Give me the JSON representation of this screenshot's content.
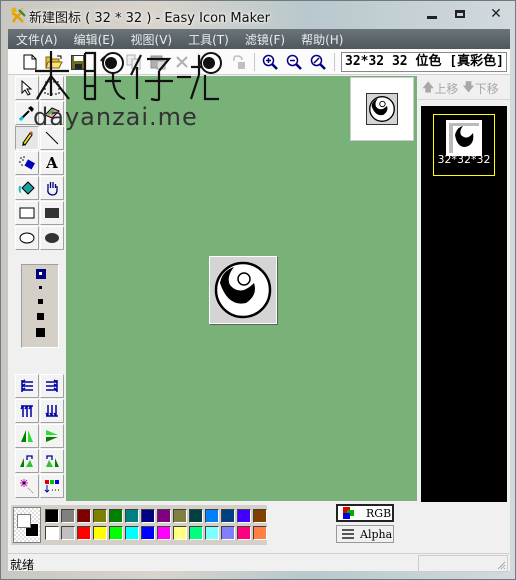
{
  "window": {
    "title": "新建图标 ( 32 * 32 ) - Easy Icon Maker",
    "controls": {
      "minimize": "—",
      "maximize": "□",
      "close": "✕"
    }
  },
  "menu": [
    "文件(A)",
    "编辑(E)",
    "视图(V)",
    "工具(T)",
    "滤镜(F)",
    "帮助(H)"
  ],
  "toolbar": {
    "buttons": [
      {
        "name": "new",
        "icon": "new-file-icon",
        "enabled": true
      },
      {
        "name": "open",
        "icon": "open-folder-icon",
        "enabled": true
      },
      {
        "name": "save",
        "icon": "save-icon",
        "enabled": true
      },
      {
        "name": "cut",
        "icon": "cut-icon",
        "enabled": false
      },
      {
        "name": "copy",
        "icon": "copy-icon",
        "enabled": false
      },
      {
        "name": "paste",
        "icon": "paste-icon",
        "enabled": false
      },
      {
        "name": "delete",
        "icon": "delete-icon",
        "enabled": false
      },
      {
        "name": "undo",
        "icon": "undo-icon",
        "enabled": true
      },
      {
        "name": "redo",
        "icon": "redo-icon",
        "enabled": false
      },
      {
        "name": "zoom-in",
        "icon": "zoom-in-icon",
        "enabled": true
      },
      {
        "name": "zoom-out",
        "icon": "zoom-out-icon",
        "enabled": true
      },
      {
        "name": "zoom-fit",
        "icon": "zoom-fit-icon",
        "enabled": true
      }
    ],
    "format": "32*32  32 位色 [真彩色]"
  },
  "tools": [
    {
      "name": "select",
      "icon": "arrow-select-icon"
    },
    {
      "name": "rect-select",
      "icon": "rect-select-icon"
    },
    {
      "name": "eyedropper",
      "icon": "eyedropper-icon"
    },
    {
      "name": "eraser",
      "icon": "eraser-icon"
    },
    {
      "name": "pencil",
      "icon": "pencil-icon",
      "active": true
    },
    {
      "name": "line",
      "icon": "line-icon"
    },
    {
      "name": "spray",
      "icon": "spray-icon"
    },
    {
      "name": "text",
      "icon": "text-icon",
      "glyph": "A"
    },
    {
      "name": "fill",
      "icon": "paint-bucket-icon"
    },
    {
      "name": "hand",
      "icon": "hand-icon"
    },
    {
      "name": "rectangle",
      "icon": "rectangle-icon"
    },
    {
      "name": "filled-rectangle",
      "icon": "filled-rectangle-icon"
    },
    {
      "name": "ellipse",
      "icon": "ellipse-icon"
    },
    {
      "name": "filled-ellipse",
      "icon": "filled-ellipse-icon"
    }
  ],
  "brush_sizes": {
    "options": [
      1,
      2,
      3,
      4,
      5
    ],
    "selected": 1
  },
  "transforms": [
    {
      "name": "shift-left",
      "icon": "shift-left-icon"
    },
    {
      "name": "shift-right",
      "icon": "shift-right-icon"
    },
    {
      "name": "shift-up",
      "icon": "shift-up-icon"
    },
    {
      "name": "shift-down",
      "icon": "shift-down-icon"
    },
    {
      "name": "flip-horizontal",
      "icon": "flip-horizontal-icon"
    },
    {
      "name": "flip-vertical",
      "icon": "flip-vertical-icon"
    },
    {
      "name": "rotate-left",
      "icon": "rotate-left-icon"
    },
    {
      "name": "rotate-right",
      "icon": "rotate-right-icon"
    },
    {
      "name": "effects",
      "icon": "sparkle-icon"
    },
    {
      "name": "color-replace",
      "icon": "color-replace-icon"
    }
  ],
  "canvas": {
    "background": "#78b279"
  },
  "side_panel": {
    "move_up": "上移",
    "move_down": "下移",
    "entries": [
      {
        "label": "32*32*32",
        "selected": true
      }
    ]
  },
  "palette": {
    "foreground": "#000000",
    "background": "#ffffff",
    "row1": [
      "#000000",
      "#808080",
      "#800000",
      "#808000",
      "#008000",
      "#008080",
      "#000080",
      "#800080",
      "#808040",
      "#004040",
      "#0080ff",
      "#004080",
      "#4000ff",
      "#804000"
    ],
    "row2": [
      "#ffffff",
      "#c0c0c0",
      "#ff0000",
      "#ffff00",
      "#00ff00",
      "#00ffff",
      "#0000ff",
      "#ff00ff",
      "#ffff80",
      "#00ff80",
      "#80ffff",
      "#8080ff",
      "#ff0080",
      "#ff8040"
    ]
  },
  "modes": {
    "rgb": "RGB",
    "alpha": "Alpha",
    "selected": "rgb"
  },
  "status": {
    "text": "就绪"
  },
  "watermark": {
    "title": "大眼仔-旭",
    "url": "dayanzai.me"
  }
}
